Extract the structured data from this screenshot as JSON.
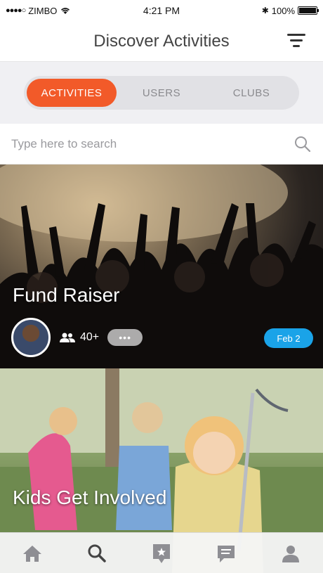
{
  "status_bar": {
    "carrier": "ZIMBO",
    "time": "4:21 PM",
    "battery": "100%"
  },
  "header": {
    "title": "Discover Activities"
  },
  "segments": [
    {
      "label": "ACTIVITIES",
      "active": true
    },
    {
      "label": "USERS",
      "active": false
    },
    {
      "label": "CLUBS",
      "active": false
    }
  ],
  "search": {
    "placeholder": "Type here to search"
  },
  "cards": [
    {
      "title": "Fund Raiser",
      "attendees": "40+",
      "more": "•••",
      "date": "Feb 2"
    },
    {
      "title": "Kids Get Involved"
    }
  ],
  "tab_bar": {
    "items": [
      "home-icon",
      "search-icon",
      "add-activity-icon",
      "messages-icon",
      "profile-icon"
    ],
    "active": "search-icon"
  },
  "colors": {
    "accent": "#f25a29",
    "badge": "#1aa3e8"
  }
}
